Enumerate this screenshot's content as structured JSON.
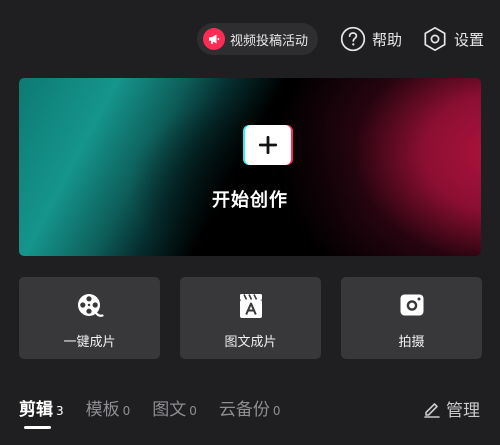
{
  "header": {
    "promo_label": "视频投稿活动",
    "help_label": "帮助",
    "settings_label": "设置"
  },
  "hero": {
    "title": "开始创作"
  },
  "actions": {
    "one_click_label": "一键成片",
    "image_text_label": "图文成片",
    "shoot_label": "拍摄"
  },
  "tabs": {
    "edit": {
      "label": "剪辑",
      "count": "3"
    },
    "templates": {
      "label": "模板",
      "count": "0"
    },
    "image_text": {
      "label": "图文",
      "count": "0"
    },
    "cloud_backup": {
      "label": "云备份",
      "count": "0"
    },
    "active": "edit"
  },
  "manage_label": "管理",
  "colors": {
    "background": "#1f1f21",
    "card": "#38383b",
    "accent_red": "#fe2c55",
    "accent_cyan": "#25f4ee",
    "text_primary": "#ffffff",
    "text_muted": "#8e8e92"
  },
  "icons": {
    "promo": "megaphone-icon",
    "help": "question-circle-icon",
    "settings": "hexagon-gear-icon",
    "start": "plus-icon",
    "one_click": "film-reel-icon",
    "image_text": "clapper-a-icon",
    "shoot": "camera-icon",
    "manage": "pencil-icon"
  }
}
